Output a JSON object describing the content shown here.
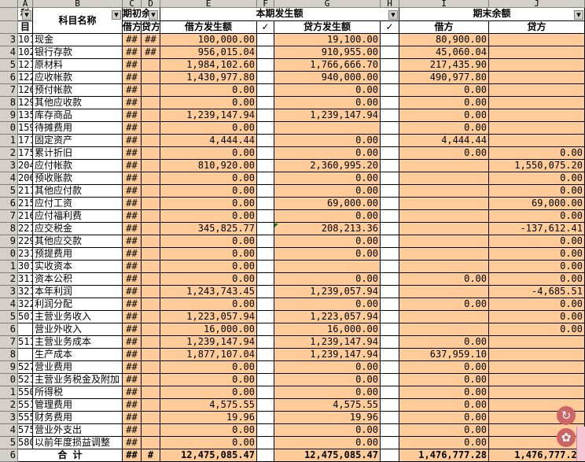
{
  "columns": [
    "A",
    "B",
    "C",
    "D",
    "E",
    "F",
    "G",
    "H",
    "I",
    "J"
  ],
  "header": {
    "code_top": "科",
    "code_bottom": "目",
    "subject_name": "科目名称",
    "opening_balance": "期初余",
    "opening_debit": "借方",
    "opening_credit": "贷方",
    "current_period": "本期发生额",
    "debit_amount": "借方发生额",
    "credit_amount": "贷方发生额",
    "check_mark": "✓",
    "ending_balance": "期末余额",
    "ending_debit": "借方",
    "ending_credit": "贷方"
  },
  "row_numbers": [
    "",
    "",
    "3",
    "4",
    "5",
    "6",
    "7",
    "8",
    "9",
    "0",
    "1",
    "2",
    "3",
    "4",
    "5",
    "6",
    "7",
    "8",
    "9",
    "0",
    "1",
    "2",
    "3",
    "4",
    "5",
    "6",
    "7",
    "8",
    "9",
    "0",
    "1",
    "2",
    "3",
    "4",
    "5",
    "6"
  ],
  "rows": [
    {
      "code": "101",
      "name": "现金",
      "c": "##",
      "d": "##",
      "e": "100,000.00",
      "g": "19,100.00",
      "i": "80,900.00",
      "j": ""
    },
    {
      "code": "102",
      "name": "银行存款",
      "c": "##",
      "d": "##",
      "e": "956,015.04",
      "g": "910,955.00",
      "i": "45,060.04",
      "j": ""
    },
    {
      "code": "121",
      "name": "原材料",
      "c": "##",
      "d": "",
      "e": "1,984,102.60",
      "g": "1,766,666.70",
      "i": "217,435.90",
      "j": ""
    },
    {
      "code": "122",
      "name": "应收帐款",
      "c": "##",
      "d": "",
      "e": "1,430,977.80",
      "g": "940,000.00",
      "i": "490,977.80",
      "j": ""
    },
    {
      "code": "126",
      "name": "预付帐款",
      "c": "##",
      "d": "",
      "e": "0.00",
      "g": "0.00",
      "i": "0.00",
      "j": ""
    },
    {
      "code": "129",
      "name": "其他应收款",
      "c": "##",
      "d": "",
      "e": "0.00",
      "g": "0.00",
      "i": "0.00",
      "j": ""
    },
    {
      "code": "135",
      "name": "库存商品",
      "c": "##",
      "d": "",
      "e": "1,239,147.94",
      "g": "1,239,147.94",
      "i": "0.00",
      "j": ""
    },
    {
      "code": "159",
      "name": "待摊费用",
      "c": "##",
      "d": "",
      "e": "0.00",
      "g": "",
      "i": "0.00",
      "j": ""
    },
    {
      "code": "171",
      "name": "固定资产",
      "c": "##",
      "d": "",
      "e": "4,444.44",
      "g": "0.00",
      "i": "4,444.44",
      "j": ""
    },
    {
      "code": "175",
      "name": "累计折旧",
      "c": "##",
      "d": "",
      "e": "0.00",
      "g": "0.00",
      "i": "0.00",
      "j": "0.00"
    },
    {
      "code": "204",
      "name": "应付帐款",
      "c": "##",
      "d": "",
      "e": "810,920.00",
      "g": "2,360,995.20",
      "i": "",
      "j": "1,550,075.20"
    },
    {
      "code": "206",
      "name": "预收账款",
      "c": "##",
      "d": "",
      "e": "0.00",
      "g": "0.00",
      "i": "",
      "j": "0.00"
    },
    {
      "code": "211",
      "name": "其他应付款",
      "c": "##",
      "d": "",
      "e": "0.00",
      "g": "0.00",
      "i": "",
      "j": "0.00"
    },
    {
      "code": "215",
      "name": "应付工资",
      "c": "##",
      "d": "",
      "e": "0.00",
      "g": "69,000.00",
      "i": "",
      "j": "69,000.00"
    },
    {
      "code": "216",
      "name": "应付福利费",
      "c": "##",
      "d": "",
      "e": "0.00",
      "g": "0.00",
      "i": "",
      "j": "0.00"
    },
    {
      "code": "221",
      "name": "应交税金",
      "c": "##",
      "d": "",
      "e": "345,825.77",
      "g": "208,213.36",
      "i": "",
      "j": "-137,612.41"
    },
    {
      "code": "229",
      "name": "其他应交款",
      "c": "##",
      "d": "",
      "e": "0.00",
      "g": "0.00",
      "i": "",
      "j": "0.00"
    },
    {
      "code": "231",
      "name": "预提费用",
      "c": "##",
      "d": "",
      "e": "0.00",
      "g": "0.00",
      "i": "",
      "j": "0.00"
    },
    {
      "code": "301",
      "name": "实收资本",
      "c": "##",
      "d": "",
      "e": "0.00",
      "g": "",
      "i": "",
      "j": "0.00"
    },
    {
      "code": "311",
      "name": "资本公积",
      "c": "##",
      "d": "",
      "e": "0.00",
      "g": "0.00",
      "i": "0.00",
      "j": "0.00"
    },
    {
      "code": "321",
      "name": "本年利润",
      "c": "##",
      "d": "",
      "e": "1,243,743.45",
      "g": "1,239,057.94",
      "i": "",
      "j": "-4,685.51"
    },
    {
      "code": "322",
      "name": "利润分配",
      "c": "##",
      "d": "",
      "e": "0.00",
      "g": "0.00",
      "i": "0.00",
      "j": "0.00"
    },
    {
      "code": "501",
      "name": "主营业务收入",
      "c": "##",
      "d": "",
      "e": "1,223,057.94",
      "g": "1,223,057.94",
      "i": "",
      "j": "0.00"
    },
    {
      "code": "",
      "name": "营业外收入",
      "c": "##",
      "d": "",
      "e": "16,000.00",
      "g": "16,000.00",
      "i": "",
      "j": "0.00"
    },
    {
      "code": "511",
      "name": "主营业务成本",
      "c": "##",
      "d": "",
      "e": "1,239,147.94",
      "g": "1,239,147.94",
      "i": "0.00",
      "j": ""
    },
    {
      "code": "",
      "name": "生产成本",
      "c": "##",
      "d": "",
      "e": "1,877,107.04",
      "g": "1,239,147.94",
      "i": "637,959.10",
      "j": ""
    },
    {
      "code": "527",
      "name": "营业费用",
      "c": "##",
      "d": "",
      "e": "0.00",
      "g": "0.00",
      "i": "0.00",
      "j": ""
    },
    {
      "code": "521",
      "name": "主营业务税金及附加",
      "c": "##",
      "d": "",
      "e": "0.00",
      "g": "0.00",
      "i": "0.00",
      "j": ""
    },
    {
      "code": "550",
      "name": "所得税",
      "c": "##",
      "d": "",
      "e": "0.00",
      "g": "0.00",
      "i": "0.00",
      "j": ""
    },
    {
      "code": "551",
      "name": "管理费用",
      "c": "##",
      "d": "",
      "e": "4,575.55",
      "g": "4,575.55",
      "i": "0.00",
      "j": ""
    },
    {
      "code": "555",
      "name": "财务费用",
      "c": "##",
      "d": "",
      "e": "19.96",
      "g": "19.96",
      "i": "0.00",
      "j": ""
    },
    {
      "code": "575",
      "name": "营业外支出",
      "c": "##",
      "d": "",
      "e": "0.00",
      "g": "0.00",
      "i": "0.00",
      "j": ""
    },
    {
      "code": "580",
      "name": "以前年度损益调整",
      "c": "##",
      "d": "",
      "e": "0.00",
      "g": "0.00",
      "i": "0.00",
      "j": ""
    }
  ],
  "total": {
    "label": "合  计",
    "c": "##",
    "d": "#",
    "e": "12,475,085.47",
    "g": "12,475,085.47",
    "i": "1,476,777.28",
    "j": "1,476,777.28"
  },
  "floating_icons": [
    "↻",
    "✿"
  ],
  "colors": {
    "orange_fill": "#ffcc99",
    "header_gray": "#d4d0c8",
    "grid": "#000000"
  }
}
